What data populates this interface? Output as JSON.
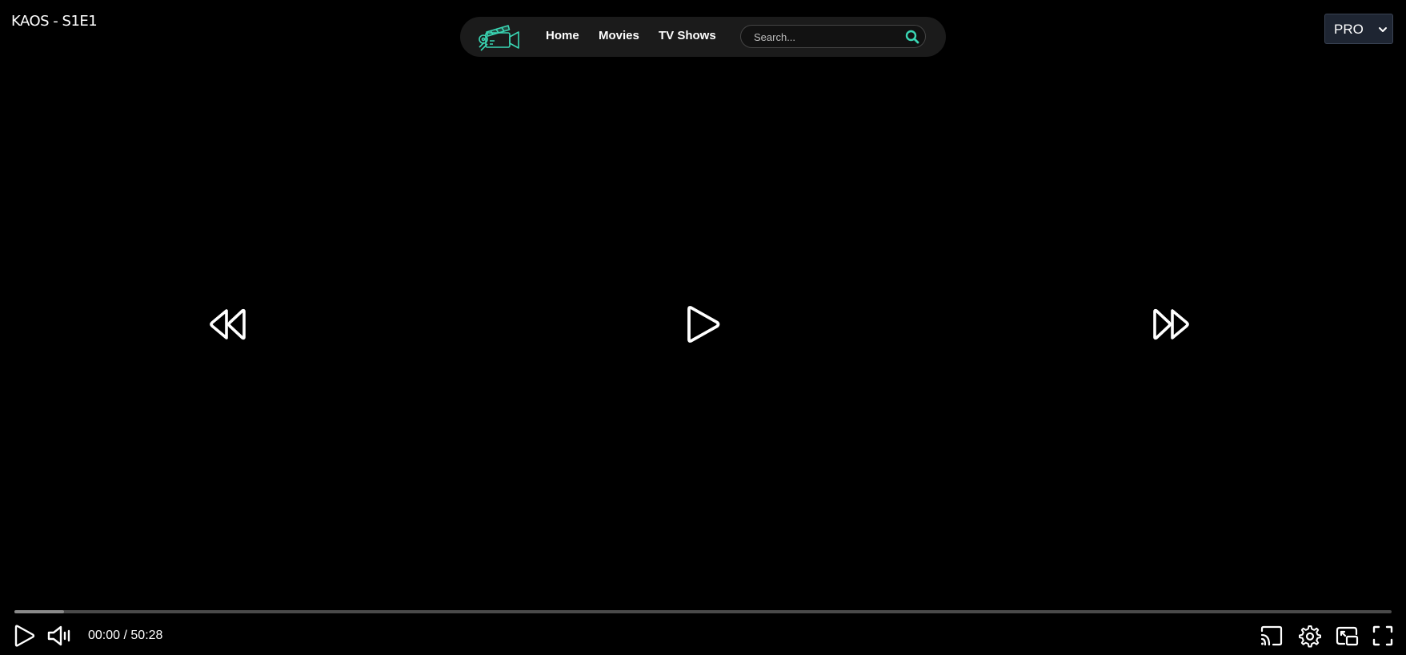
{
  "video": {
    "title": "KAOS - S1E1",
    "current_time": "00:00",
    "duration": "50:28",
    "buffered_fraction": 0.036,
    "played_fraction": 0
  },
  "nav": {
    "logo_icon": "film-camera-logo",
    "links": [
      "Home",
      "Movies",
      "TV Shows"
    ],
    "search_placeholder": "Search...",
    "search_value": "",
    "accent_color": "#3ad6b4"
  },
  "quality": {
    "selected": "PRO"
  },
  "controls": {
    "center": [
      "rewind-icon",
      "play-icon",
      "fast-forward-icon"
    ],
    "bottom_left": [
      "play-icon",
      "volume-icon"
    ],
    "bottom_right": [
      "cast-icon",
      "gear-icon",
      "picture-in-picture-icon",
      "fullscreen-icon"
    ]
  },
  "colors": {
    "background": "#000000",
    "navbar": "#1b1b1b",
    "progress_track": "#4a4a4a",
    "progress_buffer": "#8a8a8a",
    "select_background": "#1e2532"
  }
}
